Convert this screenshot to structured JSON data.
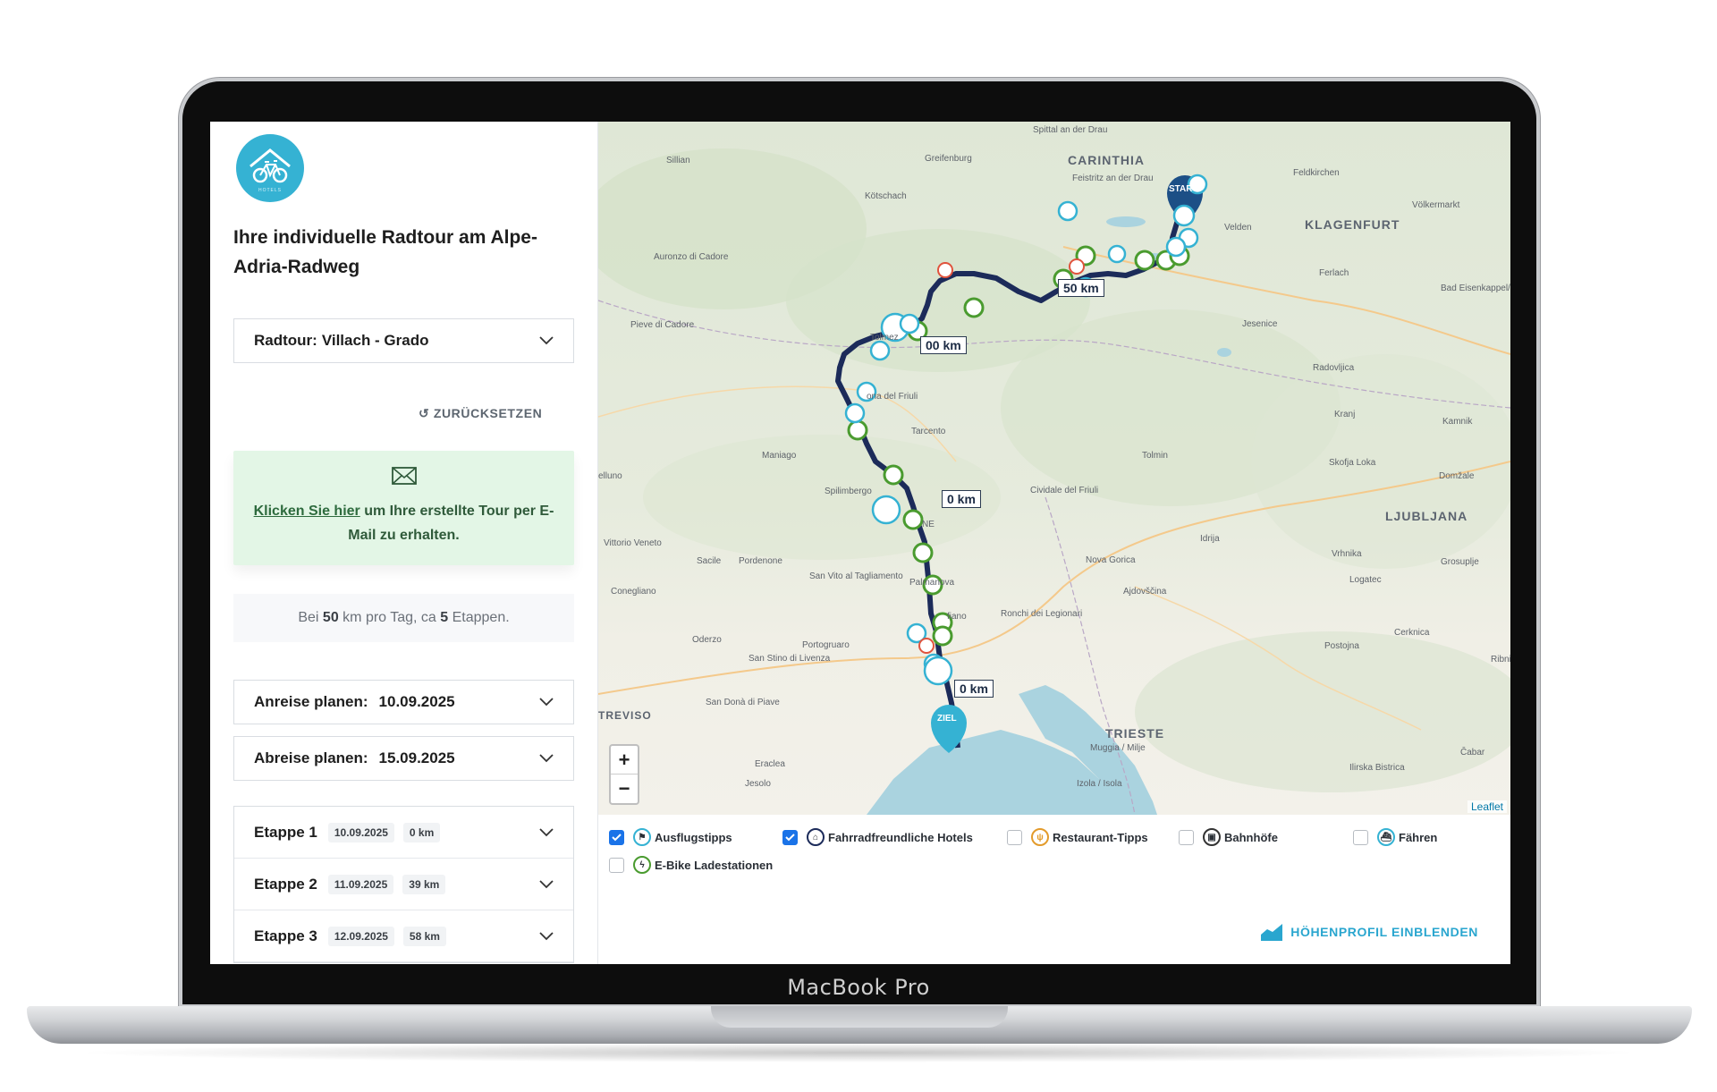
{
  "device": {
    "label": "MacBook Pro"
  },
  "sidebar": {
    "title": "Ihre individuelle Radtour am Alpe-Adria-Radweg",
    "tour_select": {
      "prefix": "Radtour:",
      "value": "Villach - Grado"
    },
    "reset_label": "↺ ZURÜCKSETZEN",
    "email_box": {
      "link_text": "Klicken Sie hier",
      "text_rest": " um Ihre erstellte Tour per E-Mail zu erhalten."
    },
    "info": {
      "prefix": "Bei ",
      "km": "50",
      "mid": " km pro Tag, ca ",
      "stages": "5",
      "suffix": " Etappen."
    },
    "arrival": {
      "label": "Anreise planen:",
      "date": "10.09.2025"
    },
    "departure": {
      "label": "Abreise planen:",
      "date": "15.09.2025"
    },
    "stages": [
      {
        "name": "Etappe 1",
        "date": "10.09.2025",
        "km": "0 km"
      },
      {
        "name": "Etappe 2",
        "date": "11.09.2025",
        "km": "39 km"
      },
      {
        "name": "Etappe 3",
        "date": "12.09.2025",
        "km": "58 km"
      }
    ]
  },
  "map": {
    "places": {
      "carinthia": "CARINTHIA",
      "klagenfurt": "KLAGENFURT",
      "ljubljana": "LJUBLJANA",
      "trieste": "TRIESTE",
      "spittal": "Spittal an der Drau",
      "sillian": "Sillian",
      "greifenburg": "Greifenburg",
      "feldkirchen": "Feldkirchen",
      "feistritz": "Feistritz an der Drau",
      "kotschach": "Kötschach",
      "volkermarkt": "Völkermarkt",
      "velden": "Velden",
      "auronzo": "Auronzo di Cadore",
      "ferlach": "Ferlach",
      "bad_eisenkappel": "Bad Eisenkappel/ Železna Kapla",
      "pieve": "Pieve di Cadore",
      "tolmezzo": "Tolmez",
      "jesenice": "Jesenice",
      "radovljica": "Radovljica",
      "gemona": "ona del Friuli",
      "tarcento": "Tarcento",
      "kranj": "Kranj",
      "kamnik": "Kamnik",
      "maniago": "Maniago",
      "tolmin": "Tolmin",
      "skofja": "Skofja Loka",
      "domzale": "Domžale",
      "spilimbergo": "Spilimbergo",
      "cividale": "Cividale del Friuli",
      "belluno": "elluno",
      "vittorio": "Vittorio Veneto",
      "idrija": "Idrija",
      "vrhnika": "Vrhnika",
      "sacile": "Sacile",
      "pordenone": "Pordenone",
      "nova_gorica": "Nova Gorica",
      "grosuplje": "Grosuplje",
      "conegliano": "Conegliano",
      "san_vito": "San Vito al Tagliamento",
      "palmanova": "Palmanova",
      "ajdovscina": "Ajdovščina",
      "logatec": "Logatec",
      "ronchi": "Ronchi dei Legionari",
      "monfalcone": "fiano",
      "postojna": "Postojna",
      "oderzo": "Oderzo",
      "portogruaro": "Portogruaro",
      "cerknica": "Cerknica",
      "san_stino": "San Stino di Livenza",
      "ribnica": "Ribnic",
      "treviso": "TREVISO",
      "san_dona": "San Donà di Piave",
      "muggia": "Muggia / Milje",
      "cabar": "Čabar",
      "eraclea": "Eraclea",
      "ilirska": "Ilirska Bistrica",
      "jesolo": "Jesolo",
      "izola": "Izola / Isola",
      "udine": "NE"
    },
    "km_labels": [
      "50 km",
      "00 km",
      "0 km",
      "0 km"
    ],
    "start_label": "START",
    "end_label": "ZIEL",
    "zoom_in": "+",
    "zoom_out": "−",
    "attribution": "Leaflet",
    "colors": {
      "route": "#1c2b5a",
      "hotel": "#4a9b2f",
      "tip": "#35b2d3",
      "restaurant": "#e0533d",
      "water": "#aad3df"
    }
  },
  "legend": {
    "items": [
      {
        "label": "Ausflugstipps",
        "checked": true,
        "icon": "signpost-icon"
      },
      {
        "label": "Fahrradfreundliche Hotels",
        "checked": true,
        "icon": "house-icon"
      },
      {
        "label": "Restaurant-Tipps",
        "checked": false,
        "icon": "cutlery-icon"
      },
      {
        "label": "Bahnhöfe",
        "checked": false,
        "icon": "train-icon"
      },
      {
        "label": "Fähren",
        "checked": false,
        "icon": "ferry-icon"
      },
      {
        "label": "E-Bike Ladestationen",
        "checked": false,
        "icon": "charging-icon"
      }
    ],
    "elevation_button": "HÖHENPROFIL EINBLENDEN"
  }
}
